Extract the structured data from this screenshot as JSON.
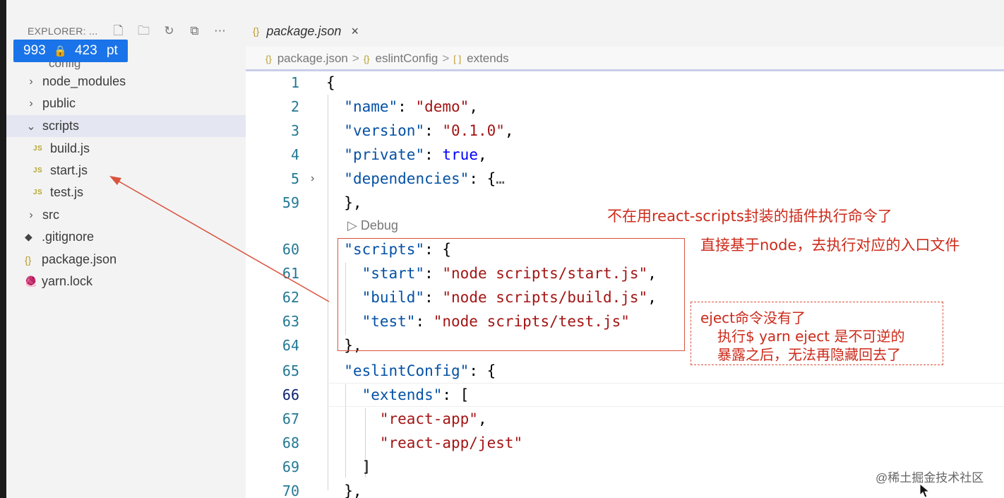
{
  "sidebar": {
    "explorer_title": "EXPLORER: ...",
    "dimensions_badge": {
      "width": "993",
      "height": "423",
      "unit": "pt"
    },
    "partial_item": "config",
    "items": [
      {
        "label": "node_modules",
        "kind": "folder",
        "expanded": false
      },
      {
        "label": "public",
        "kind": "folder",
        "expanded": false
      },
      {
        "label": "scripts",
        "kind": "folder",
        "expanded": true
      },
      {
        "label": "build.js",
        "kind": "js"
      },
      {
        "label": "start.js",
        "kind": "js"
      },
      {
        "label": "test.js",
        "kind": "js"
      },
      {
        "label": "src",
        "kind": "folder",
        "expanded": false
      },
      {
        "label": ".gitignore",
        "kind": "git"
      },
      {
        "label": "package.json",
        "kind": "json"
      },
      {
        "label": "yarn.lock",
        "kind": "yarn"
      }
    ],
    "js_badge": "JS",
    "json_badge": "{}",
    "header_icons": [
      "new-file-icon",
      "new-folder-icon",
      "refresh-icon",
      "collapse-icon",
      "more-icon"
    ]
  },
  "editor": {
    "tab_label": "package.json",
    "tab_icon": "{}",
    "tab_close": "×",
    "breadcrumb": [
      {
        "icon": "{}",
        "label": "package.json"
      },
      {
        "icon": "{}",
        "label": "eslintConfig"
      },
      {
        "icon": "[ ]",
        "label": "extends"
      }
    ],
    "breadcrumb_sep": ">",
    "debug_lens": "▷ Debug",
    "current_line": "66",
    "lines": [
      {
        "n": "1"
      },
      {
        "n": "2"
      },
      {
        "n": "3"
      },
      {
        "n": "4"
      },
      {
        "n": "5"
      },
      {
        "n": "59"
      },
      {
        "n": "60"
      },
      {
        "n": "61"
      },
      {
        "n": "62"
      },
      {
        "n": "63"
      },
      {
        "n": "64"
      },
      {
        "n": "65"
      },
      {
        "n": "66"
      },
      {
        "n": "67"
      },
      {
        "n": "68"
      },
      {
        "n": "69"
      },
      {
        "n": "70"
      }
    ],
    "code": {
      "name_key": "\"name\"",
      "name_val": "\"demo\"",
      "version_key": "\"version\"",
      "version_val": "\"0.1.0\"",
      "private_key": "\"private\"",
      "private_val": "true",
      "deps_key": "\"dependencies\"",
      "deps_fold": "…",
      "scripts_key": "\"scripts\"",
      "start_key": "\"start\"",
      "start_val": "\"node scripts/start.js\"",
      "build_key": "\"build\"",
      "build_val": "\"node scripts/build.js\"",
      "test_key": "\"test\"",
      "test_val": "\"node scripts/test.js\"",
      "eslint_key": "\"eslintConfig\"",
      "extends_key": "\"extends\"",
      "ext1": "\"react-app\"",
      "ext2": "\"react-app/jest\""
    }
  },
  "annotations": {
    "note1": "不在用react-scripts封装的插件执行命令了",
    "note2": "直接基于node，去执行对应的入口文件",
    "eject_line1": "eject命令没有了",
    "eject_line2": "执行$ yarn eject 是不可逆的",
    "eject_line3": "暴露之后，无法再隐藏回去了",
    "color": "#cc2a1a"
  },
  "watermark": "@稀土掘金技术社区"
}
